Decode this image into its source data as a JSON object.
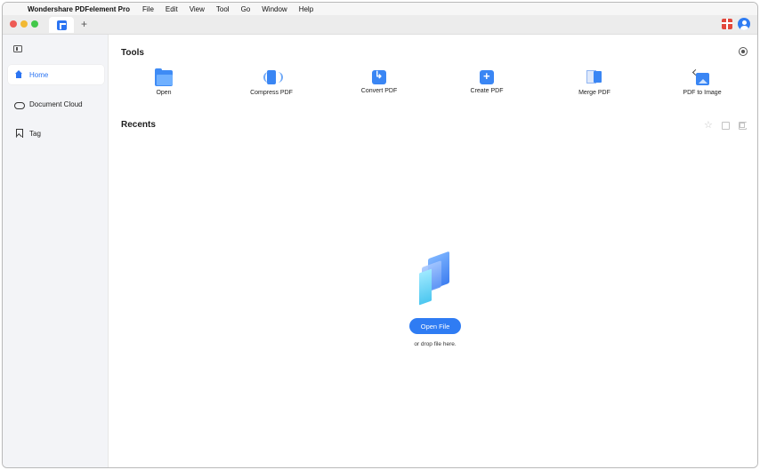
{
  "menubar": {
    "app_name": "Wondershare PDFelement Pro",
    "items": [
      "File",
      "Edit",
      "View",
      "Tool",
      "Go",
      "Window",
      "Help"
    ]
  },
  "titlebar": {
    "new_tab": "+"
  },
  "sidebar": {
    "items": [
      {
        "label": "Home",
        "icon": "home-icon",
        "active": true
      },
      {
        "label": "Document Cloud",
        "icon": "cloud-icon",
        "active": false
      },
      {
        "label": "Tag",
        "icon": "bookmark-icon",
        "active": false
      }
    ]
  },
  "main": {
    "tools_title": "Tools",
    "recents_title": "Recents",
    "tools": [
      {
        "label": "Open",
        "icon": "folder-open-icon"
      },
      {
        "label": "Compress PDF",
        "icon": "compress-pdf-icon"
      },
      {
        "label": "Convert PDF",
        "icon": "convert-pdf-icon"
      },
      {
        "label": "Create PDF",
        "icon": "create-pdf-icon"
      },
      {
        "label": "Merge PDF",
        "icon": "merge-pdf-icon"
      },
      {
        "label": "PDF to Image",
        "icon": "pdf-to-image-icon"
      }
    ],
    "open_file_button": "Open File",
    "drop_hint": "or drop file here."
  },
  "colors": {
    "accent": "#2f7cf3",
    "sidebar_bg": "#f3f4f7"
  }
}
